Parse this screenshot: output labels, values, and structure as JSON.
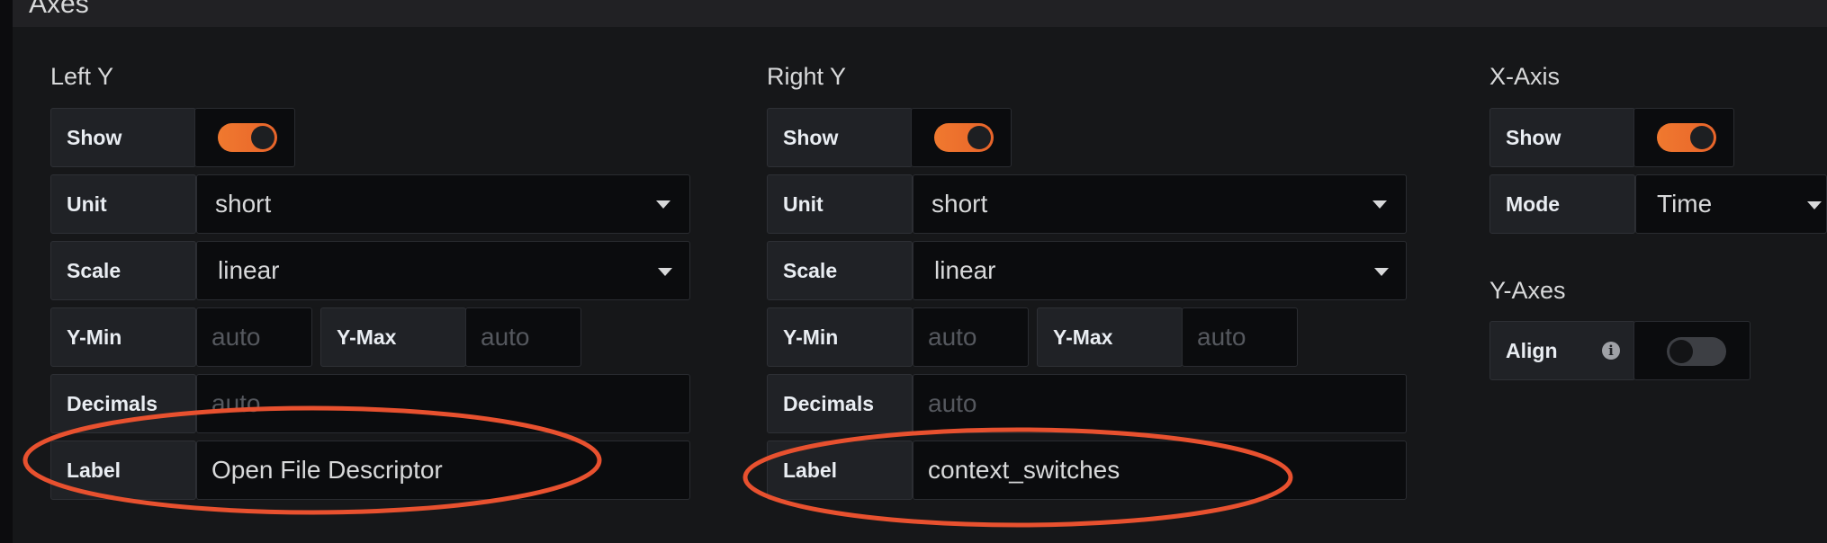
{
  "header": {
    "title": "Axes"
  },
  "left_y": {
    "title": "Left Y",
    "show_label": "Show",
    "show_on": true,
    "unit_label": "Unit",
    "unit_value": "short",
    "scale_label": "Scale",
    "scale_value": "linear",
    "ymin_label": "Y-Min",
    "ymin_placeholder": "auto",
    "ymax_label": "Y-Max",
    "ymax_placeholder": "auto",
    "decimals_label": "Decimals",
    "decimals_placeholder": "auto",
    "label_label": "Label",
    "label_value": "Open File Descriptor"
  },
  "right_y": {
    "title": "Right Y",
    "show_label": "Show",
    "show_on": true,
    "unit_label": "Unit",
    "unit_value": "short",
    "scale_label": "Scale",
    "scale_value": "linear",
    "ymin_label": "Y-Min",
    "ymin_placeholder": "auto",
    "ymax_label": "Y-Max",
    "ymax_placeholder": "auto",
    "decimals_label": "Decimals",
    "decimals_placeholder": "auto",
    "label_label": "Label",
    "label_value": "context_switches"
  },
  "x_axis": {
    "title": "X-Axis",
    "show_label": "Show",
    "show_on": true,
    "mode_label": "Mode",
    "mode_value": "Time"
  },
  "y_axes": {
    "title": "Y-Axes",
    "align_label": "Align",
    "align_on": false
  },
  "colors": {
    "accent": "#eb6a2d",
    "annotation": "#e8512f",
    "panel_bg": "#161719",
    "field_bg": "#0b0c0e",
    "label_bg": "#202226"
  },
  "icons": [
    "caret-down-icon",
    "info-icon"
  ]
}
